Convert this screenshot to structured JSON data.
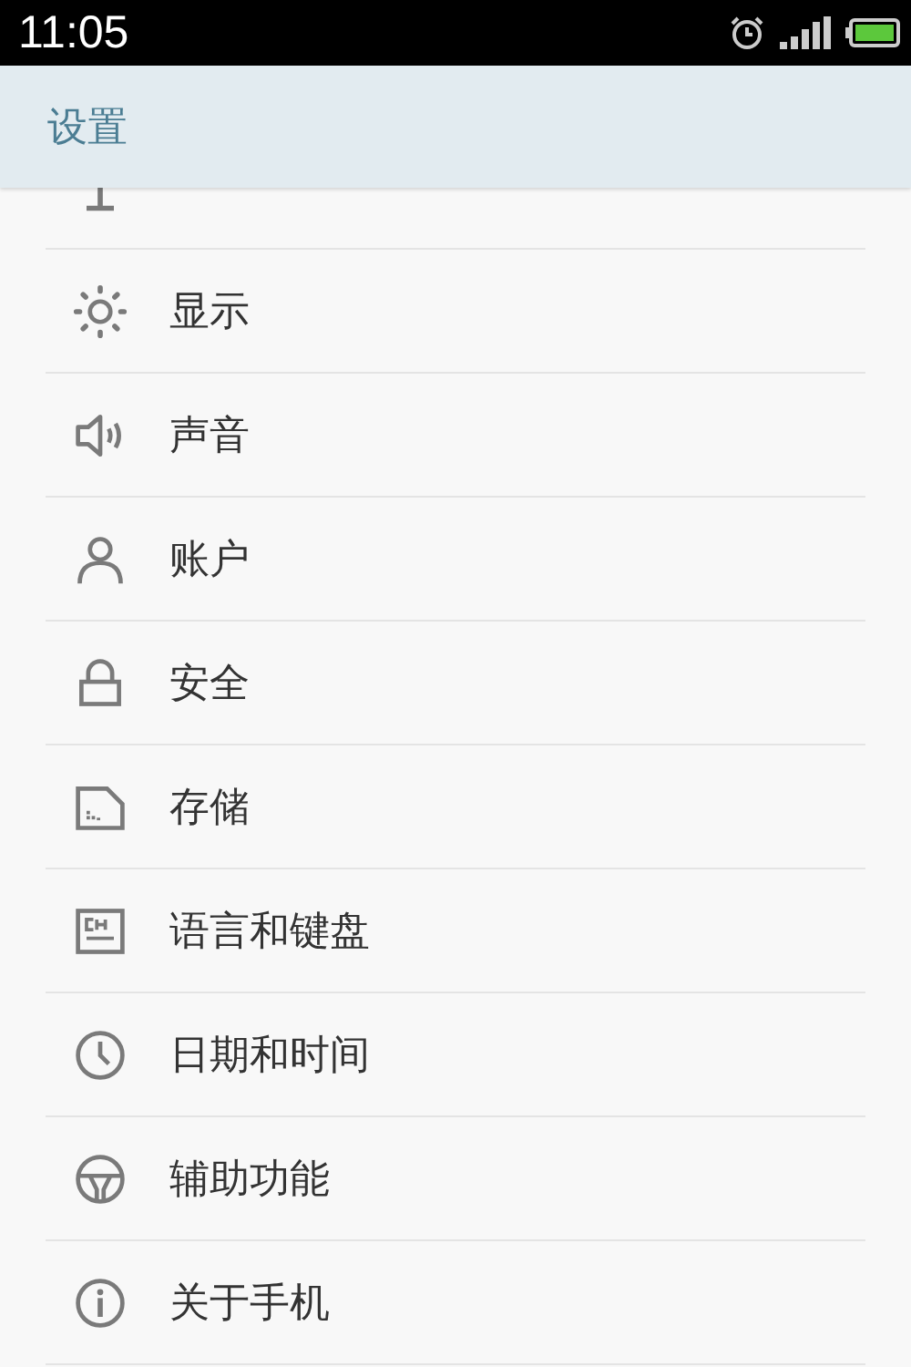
{
  "status_bar": {
    "time": "11:05"
  },
  "header": {
    "title": "设置"
  },
  "items": [
    {
      "kind": "network"
    },
    {
      "kind": "display",
      "label": "显示"
    },
    {
      "kind": "sound",
      "label": "声音"
    },
    {
      "kind": "account",
      "label": "账户"
    },
    {
      "kind": "security",
      "label": "安全"
    },
    {
      "kind": "storage",
      "label": "存储"
    },
    {
      "kind": "language",
      "label": "语言和键盘"
    },
    {
      "kind": "datetime",
      "label": "日期和时间"
    },
    {
      "kind": "accessibility",
      "label": "辅助功能"
    },
    {
      "kind": "about",
      "label": "关于手机"
    }
  ]
}
